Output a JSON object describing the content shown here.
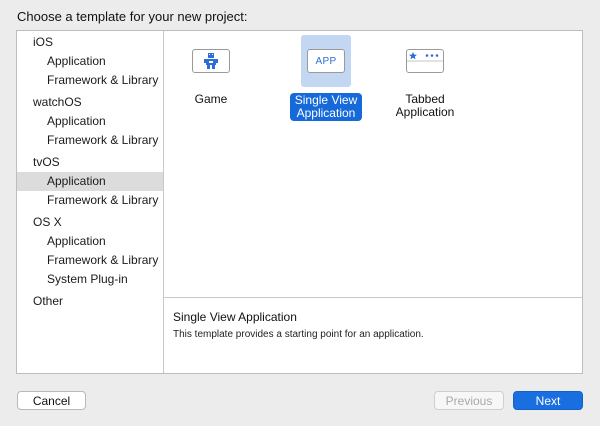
{
  "dialog": {
    "title": "Choose a template for your new project:"
  },
  "sidebar": {
    "groups": [
      {
        "label": "iOS",
        "items": [
          "Application",
          "Framework & Library"
        ]
      },
      {
        "label": "watchOS",
        "items": [
          "Application",
          "Framework & Library"
        ]
      },
      {
        "label": "tvOS",
        "items": [
          "Application",
          "Framework & Library"
        ]
      },
      {
        "label": "OS X",
        "items": [
          "Application",
          "Framework & Library",
          "System Plug-in"
        ]
      },
      {
        "label": "Other",
        "items": []
      }
    ],
    "selected": "tvOS / Application"
  },
  "templates": [
    {
      "label": "Game",
      "icon": "game-robot-icon"
    },
    {
      "label": "Single View Application",
      "label_line1": "Single View",
      "label_line2": "Application",
      "icon_text": "APP",
      "selected": true
    },
    {
      "label": "Tabbed Application",
      "label_line1": "Tabbed",
      "label_line2": "Application",
      "icon": "tab-bar-icon"
    }
  ],
  "detail": {
    "title": "Single View Application",
    "description": "This template provides a starting point for an application."
  },
  "buttons": {
    "cancel": "Cancel",
    "previous": "Previous",
    "next": "Next"
  },
  "colors": {
    "accent": "#1669d8",
    "selection_bg": "#c3d7f3",
    "sidebar_selection": "#dcdcdc"
  }
}
